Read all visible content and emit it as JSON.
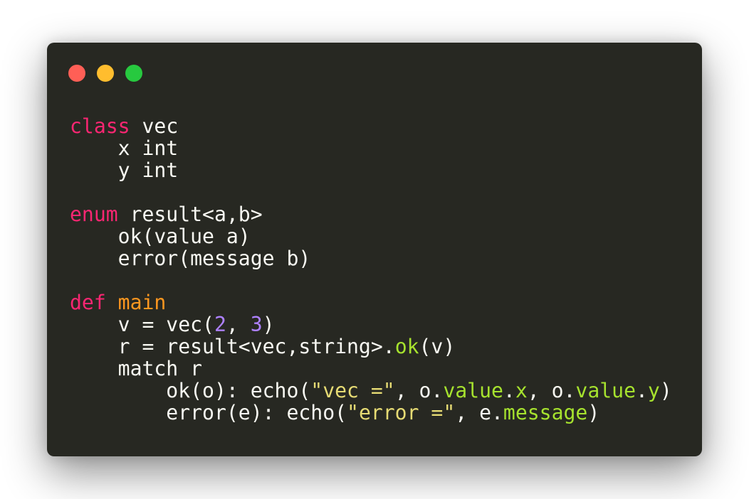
{
  "window": {
    "controls": [
      {
        "name": "close",
        "color": "#ff5f56"
      },
      {
        "name": "minimize",
        "color": "#ffbd2e"
      },
      {
        "name": "zoom",
        "color": "#27c93f"
      }
    ]
  },
  "theme": {
    "background": "#272822",
    "default": "#f8f8f2",
    "keyword": "#f92672",
    "function": "#fd971f",
    "number": "#ae81ff",
    "string": "#e6db74",
    "member": "#a6e22e"
  },
  "code": {
    "lines": [
      [
        {
          "t": "class",
          "s": "keyword"
        },
        {
          "t": " vec"
        }
      ],
      [
        {
          "t": "    x int"
        }
      ],
      [
        {
          "t": "    y int"
        }
      ],
      [],
      [
        {
          "t": "enum",
          "s": "keyword"
        },
        {
          "t": " result<a,b>"
        }
      ],
      [
        {
          "t": "    ok(value a)"
        }
      ],
      [
        {
          "t": "    error(message b)"
        }
      ],
      [],
      [
        {
          "t": "def",
          "s": "keyword"
        },
        {
          "t": " "
        },
        {
          "t": "main",
          "s": "function"
        }
      ],
      [
        {
          "t": "    v = vec("
        },
        {
          "t": "2",
          "s": "number"
        },
        {
          "t": ", "
        },
        {
          "t": "3",
          "s": "number"
        },
        {
          "t": ")"
        }
      ],
      [
        {
          "t": "    r = result<vec,string>."
        },
        {
          "t": "ok",
          "s": "member"
        },
        {
          "t": "(v)"
        }
      ],
      [
        {
          "t": "    match r"
        }
      ],
      [
        {
          "t": "        ok(o): echo("
        },
        {
          "t": "\"vec =\"",
          "s": "string"
        },
        {
          "t": ", o."
        },
        {
          "t": "value",
          "s": "member"
        },
        {
          "t": "."
        },
        {
          "t": "x",
          "s": "member"
        },
        {
          "t": ", o."
        },
        {
          "t": "value",
          "s": "member"
        },
        {
          "t": "."
        },
        {
          "t": "y",
          "s": "member"
        },
        {
          "t": ")"
        }
      ],
      [
        {
          "t": "        error(e): echo("
        },
        {
          "t": "\"error =\"",
          "s": "string"
        },
        {
          "t": ", e."
        },
        {
          "t": "message",
          "s": "member"
        },
        {
          "t": ")"
        }
      ]
    ]
  }
}
